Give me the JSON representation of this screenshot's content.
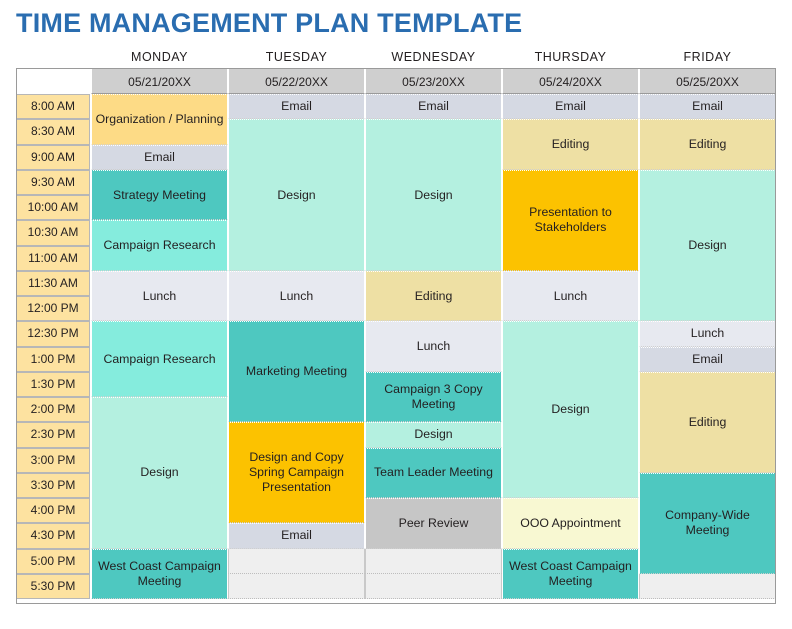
{
  "page": {
    "title": "TIME MANAGEMENT PLAN TEMPLATE",
    "title_color": "#2a6db0"
  },
  "palette": {
    "time_column": "#fde2a0",
    "date_header": "#cfcfcf",
    "empty": "#efefef",
    "email": "#d5d9e3",
    "lunch": "#e7e9f0",
    "organization": "#fddb86",
    "editing": "#eee0a4",
    "ooo": "#f8f8d2",
    "teal_dark": "#4ec8c0",
    "teal_bright": "#85ecdd",
    "mint_light": "#b4f0e0",
    "orange": "#fcc200",
    "gray_block": "#c6c6c6"
  },
  "columns": [
    {
      "day": "MONDAY",
      "date": "05/21/20XX"
    },
    {
      "day": "TUESDAY",
      "date": "05/22/20XX"
    },
    {
      "day": "WEDNESDAY",
      "date": "05/23/20XX"
    },
    {
      "day": "THURSDAY",
      "date": "05/24/20XX"
    },
    {
      "day": "FRIDAY",
      "date": "05/25/20XX"
    }
  ],
  "times": [
    "8:00 AM",
    "8:30 AM",
    "9:00 AM",
    "9:30 AM",
    "10:00 AM",
    "10:30 AM",
    "11:00 AM",
    "11:30 AM",
    "12:00 PM",
    "12:30 PM",
    "1:00 PM",
    "1:30 PM",
    "2:00 PM",
    "2:30 PM",
    "3:00 PM",
    "3:30 PM",
    "4:00 PM",
    "4:30 PM",
    "5:00 PM",
    "5:30 PM"
  ],
  "schedule": {
    "monday": [
      {
        "label": "Organization / Planning",
        "start": 0,
        "span": 2,
        "color": "#fddb86"
      },
      {
        "label": "Email",
        "start": 2,
        "span": 1,
        "color": "#d5d9e3"
      },
      {
        "label": "Strategy Meeting",
        "start": 3,
        "span": 2,
        "color": "#4ec8c0"
      },
      {
        "label": "Campaign Research",
        "start": 5,
        "span": 2,
        "color": "#85ecdd"
      },
      {
        "label": "Lunch",
        "start": 7,
        "span": 2,
        "color": "#e7e9f0"
      },
      {
        "label": "Campaign Research",
        "start": 9,
        "span": 3,
        "color": "#85ecdd"
      },
      {
        "label": "Design",
        "start": 12,
        "span": 6,
        "color": "#b4f0e0"
      },
      {
        "label": "West Coast Campaign  Meeting",
        "start": 18,
        "span": 2,
        "color": "#4ec8c0"
      }
    ],
    "tuesday": [
      {
        "label": "Email",
        "start": 0,
        "span": 1,
        "color": "#d5d9e3"
      },
      {
        "label": "Design",
        "start": 1,
        "span": 6,
        "color": "#b4f0e0"
      },
      {
        "label": "Lunch",
        "start": 7,
        "span": 2,
        "color": "#e7e9f0"
      },
      {
        "label": "Marketing Meeting",
        "start": 9,
        "span": 4,
        "color": "#4ec8c0"
      },
      {
        "label": "Design and Copy Spring Campaign Presentation",
        "start": 13,
        "span": 4,
        "color": "#fcc200"
      },
      {
        "label": "Email",
        "start": 17,
        "span": 1,
        "color": "#d5d9e3"
      }
    ],
    "wednesday": [
      {
        "label": "Email",
        "start": 0,
        "span": 1,
        "color": "#d5d9e3"
      },
      {
        "label": "Design",
        "start": 1,
        "span": 6,
        "color": "#b4f0e0"
      },
      {
        "label": "Editing",
        "start": 7,
        "span": 2,
        "color": "#eee0a4"
      },
      {
        "label": "Lunch",
        "start": 9,
        "span": 2,
        "color": "#e7e9f0"
      },
      {
        "label": "Campaign 3 Copy Meeting",
        "start": 11,
        "span": 2,
        "color": "#4ec8c0"
      },
      {
        "label": "Design",
        "start": 13,
        "span": 1,
        "color": "#b4f0e0"
      },
      {
        "label": "Team Leader Meeting",
        "start": 14,
        "span": 2,
        "color": "#4ec8c0"
      },
      {
        "label": "Peer Review",
        "start": 16,
        "span": 2,
        "color": "#c6c6c6"
      }
    ],
    "thursday": [
      {
        "label": "Email",
        "start": 0,
        "span": 1,
        "color": "#d5d9e3"
      },
      {
        "label": "Editing",
        "start": 1,
        "span": 2,
        "color": "#eee0a4"
      },
      {
        "label": "Presentation to Stakeholders",
        "start": 3,
        "span": 4,
        "color": "#fcc200"
      },
      {
        "label": "Lunch",
        "start": 7,
        "span": 2,
        "color": "#e7e9f0"
      },
      {
        "label": "Design",
        "start": 9,
        "span": 7,
        "color": "#b4f0e0"
      },
      {
        "label": "OOO Appointment",
        "start": 16,
        "span": 2,
        "color": "#f8f8d2"
      },
      {
        "label": "West Coast Campaign  Meeting",
        "start": 18,
        "span": 2,
        "color": "#4ec8c0"
      }
    ],
    "friday": [
      {
        "label": "Email",
        "start": 0,
        "span": 1,
        "color": "#d5d9e3"
      },
      {
        "label": "Editing",
        "start": 1,
        "span": 2,
        "color": "#eee0a4"
      },
      {
        "label": "Design",
        "start": 3,
        "span": 6,
        "color": "#b4f0e0"
      },
      {
        "label": "Lunch",
        "start": 9,
        "span": 1,
        "color": "#e7e9f0"
      },
      {
        "label": "Email",
        "start": 10,
        "span": 1,
        "color": "#d5d9e3"
      },
      {
        "label": "Editing",
        "start": 11,
        "span": 4,
        "color": "#eee0a4"
      },
      {
        "label": "Company-Wide Meeting",
        "start": 15,
        "span": 4,
        "color": "#4ec8c0"
      }
    ]
  }
}
